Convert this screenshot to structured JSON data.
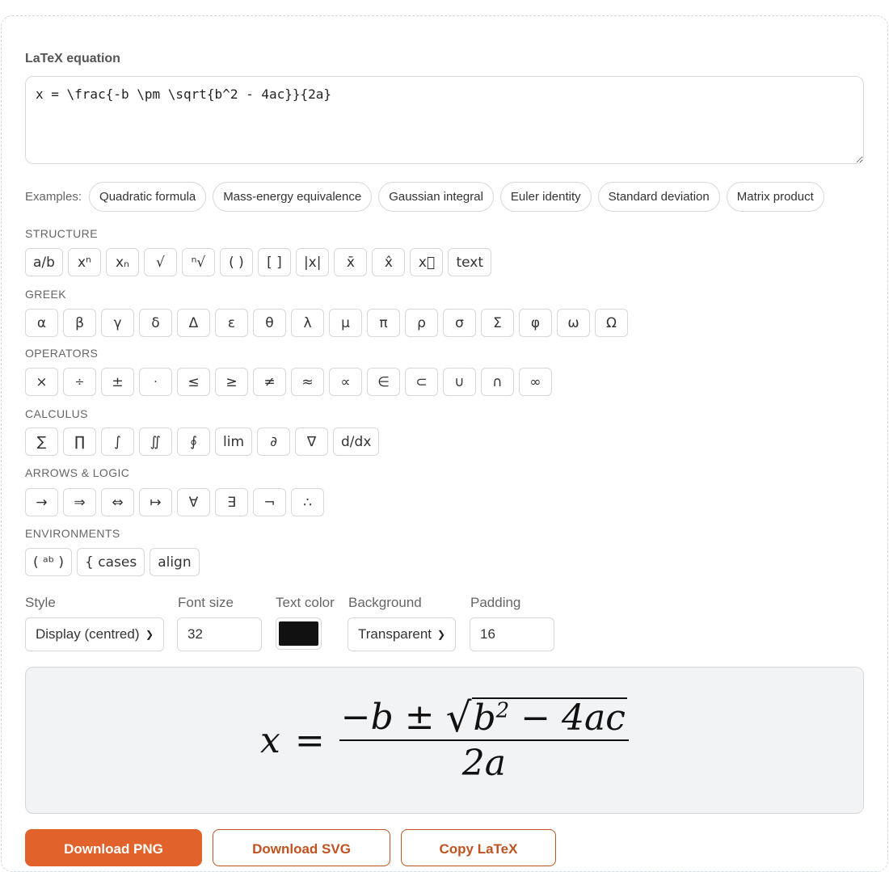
{
  "editor": {
    "label": "LaTeX equation",
    "value": "x = \\frac{-b \\pm \\sqrt{b^2 - 4ac}}{2a}"
  },
  "examples": {
    "label": "Examples:",
    "items": [
      "Quadratic formula",
      "Mass-energy equivalence",
      "Gaussian integral",
      "Euler identity",
      "Standard deviation",
      "Matrix product"
    ]
  },
  "sections": {
    "structure": {
      "title": "STRUCTURE",
      "buttons": [
        "a/b",
        "xⁿ",
        "xₙ",
        "√",
        "ⁿ√",
        "( )",
        "[ ]",
        "|x|",
        "x̄",
        "x̂",
        "x⃞",
        "text"
      ]
    },
    "greek": {
      "title": "GREEK",
      "buttons": [
        "α",
        "β",
        "γ",
        "δ",
        "Δ",
        "ε",
        "θ",
        "λ",
        "μ",
        "π",
        "ρ",
        "σ",
        "Σ",
        "φ",
        "ω",
        "Ω"
      ]
    },
    "operators": {
      "title": "OPERATORS",
      "buttons": [
        "×",
        "÷",
        "±",
        "·",
        "≤",
        "≥",
        "≠",
        "≈",
        "∝",
        "∈",
        "⊂",
        "∪",
        "∩",
        "∞"
      ]
    },
    "calculus": {
      "title": "CALCULUS",
      "buttons": [
        "∑",
        "∏",
        "∫",
        "∬",
        "∮",
        "lim",
        "∂",
        "∇",
        "d/dx"
      ]
    },
    "arrows": {
      "title": "ARROWS & LOGIC",
      "buttons": [
        "→",
        "⇒",
        "⇔",
        "↦",
        "∀",
        "∃",
        "¬",
        "∴"
      ]
    },
    "environments": {
      "title": "ENVIRONMENTS",
      "buttons": [
        "( ᵃᵇ )",
        "{ cases",
        "align"
      ]
    }
  },
  "options": {
    "style_label": "Style",
    "style_value": "Display (centred)",
    "font_size_label": "Font size",
    "font_size_value": "32",
    "text_color_label": "Text color",
    "text_color_value": "#111111",
    "background_label": "Background",
    "background_value": "Transparent",
    "padding_label": "Padding",
    "padding_value": "16"
  },
  "preview": {
    "lhs": "x",
    "equals": "=",
    "num_prefix": "−b ± ",
    "radicand_base": "b",
    "radicand_exp": "2",
    "radicand_rest": " − 4ac",
    "denominator": "2a"
  },
  "actions": {
    "download_png": "Download PNG",
    "download_svg": "Download SVG",
    "copy_latex": "Copy LaTeX"
  },
  "colors": {
    "accent": "#e2622c",
    "accent_dark": "#c0531f",
    "preview_bg": "#f1f3f5",
    "border": "#d5d8dc"
  }
}
